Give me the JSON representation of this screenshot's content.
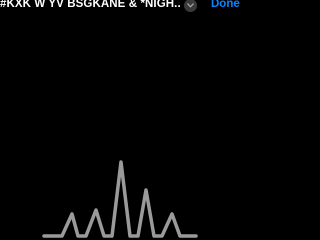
{
  "header": {
    "title": "#KXK W YV BSGKANE & *NIGH...",
    "chevron_icon": "chevron-down-icon",
    "done_label": "Done"
  },
  "colors": {
    "background": "#000000",
    "title": "#ffffff",
    "accent": "#0a84ff",
    "waveform": "#9a9a9a",
    "chevron_bg": "#3a3a3c"
  },
  "waveform": {
    "icon": "audio-waveform"
  }
}
